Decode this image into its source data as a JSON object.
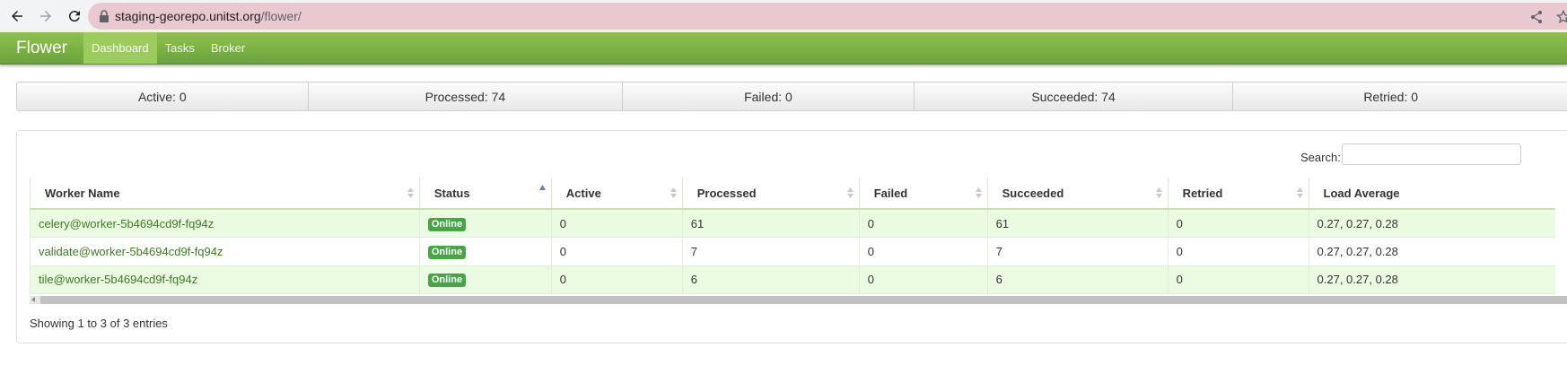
{
  "browser": {
    "url_host": "staging-georepo.unitst.org",
    "url_path": "/flower/"
  },
  "navbar": {
    "brand": "Flower",
    "items": [
      {
        "label": "Dashboard",
        "active": true
      },
      {
        "label": "Tasks",
        "active": false
      },
      {
        "label": "Broker",
        "active": false
      }
    ]
  },
  "summary": [
    {
      "label": "Active: 0"
    },
    {
      "label": "Processed: 74"
    },
    {
      "label": "Failed: 0"
    },
    {
      "label": "Succeeded: 74"
    },
    {
      "label": "Retried: 0"
    }
  ],
  "search": {
    "label": "Search:",
    "value": ""
  },
  "table": {
    "columns": [
      "Worker Name",
      "Status",
      "Active",
      "Processed",
      "Failed",
      "Succeeded",
      "Retried",
      "Load Average"
    ],
    "rows": [
      {
        "name": "celery@worker-5b4694cd9f-fq94z",
        "status": "Online",
        "active": "0",
        "processed": "61",
        "failed": "0",
        "succeeded": "61",
        "retried": "0",
        "load": "0.27, 0.27, 0.28"
      },
      {
        "name": "validate@worker-5b4694cd9f-fq94z",
        "status": "Online",
        "active": "0",
        "processed": "7",
        "failed": "0",
        "succeeded": "7",
        "retried": "0",
        "load": "0.27, 0.27, 0.28"
      },
      {
        "name": "tile@worker-5b4694cd9f-fq94z",
        "status": "Online",
        "active": "0",
        "processed": "6",
        "failed": "0",
        "succeeded": "6",
        "retried": "0",
        "load": "0.27, 0.27, 0.28"
      }
    ],
    "info": "Showing 1 to 3 of 3 entries"
  },
  "colors": {
    "navbar": "#7bb443",
    "online_badge": "#47a447",
    "row_highlight": "#eafbe1",
    "link": "#3d7a24"
  }
}
